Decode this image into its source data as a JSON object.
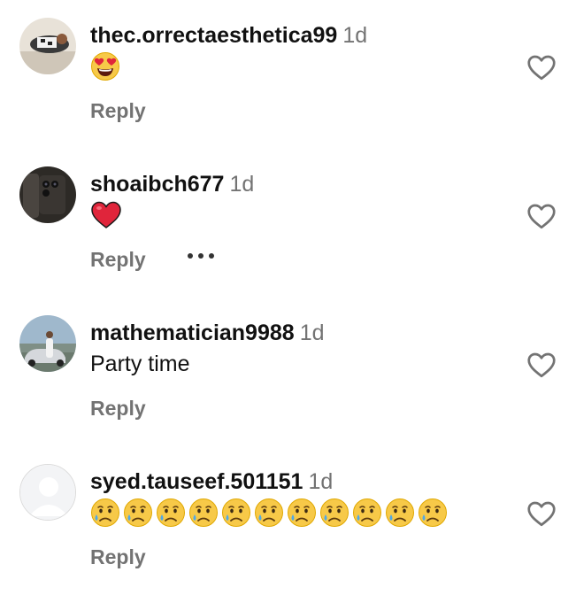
{
  "comments": [
    {
      "username": "thec.orrectaesthetica99",
      "time": "1d",
      "reply": "Reply",
      "body_type": "emoji",
      "emoji": [
        "heart-eyes"
      ],
      "avatar": "photo-person-lying"
    },
    {
      "username": "shoaibch677",
      "time": "1d",
      "reply": "Reply",
      "body_type": "emoji",
      "emoji": [
        "red-heart"
      ],
      "avatar": "photo-phone",
      "more_icon": true
    },
    {
      "username": "mathematician9988",
      "time": "1d",
      "text": "Party time",
      "reply": "Reply",
      "body_type": "text",
      "avatar": "photo-person-car"
    },
    {
      "username": "syed.tauseef.501151",
      "time": "1d",
      "reply": "Reply",
      "body_type": "emoji",
      "emoji": [
        "crying-face",
        "crying-face",
        "crying-face",
        "crying-face",
        "crying-face",
        "crying-face",
        "crying-face",
        "crying-face",
        "crying-face",
        "crying-face",
        "crying-face"
      ],
      "avatar": "default-avatar"
    }
  ],
  "icons": {
    "like": "heart-outline-icon",
    "more": "more-horizontal-icon"
  },
  "colors": {
    "username": "#111111",
    "meta": "#737373",
    "heart": "#e0253b"
  }
}
